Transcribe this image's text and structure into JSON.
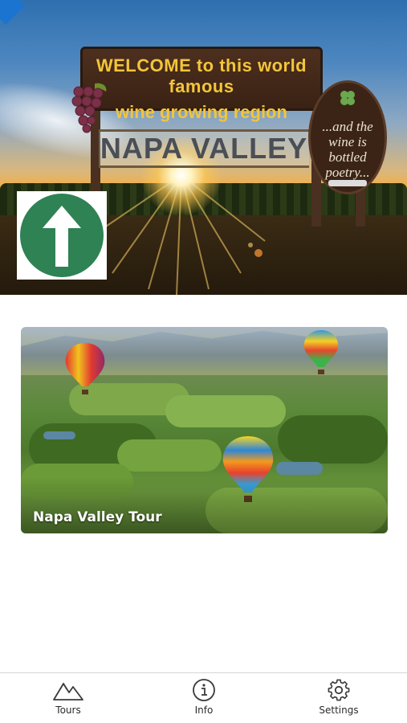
{
  "hero": {
    "sign_line1": "WELCOME to this world famous",
    "sign_line2": "wine growing region",
    "sign_name": "NAPA VALLEY",
    "oval_text": "...and the wine is bottled poetry...",
    "nav_icon": "up-arrow-icon",
    "nav_color": "#2f8253"
  },
  "tours": [
    {
      "title": "Napa Valley Tour"
    }
  ],
  "tabbar": {
    "items": [
      {
        "label": "Tours",
        "icon": "mountains-icon"
      },
      {
        "label": "Info",
        "icon": "info-icon"
      },
      {
        "label": "Settings",
        "icon": "gear-icon"
      }
    ]
  }
}
